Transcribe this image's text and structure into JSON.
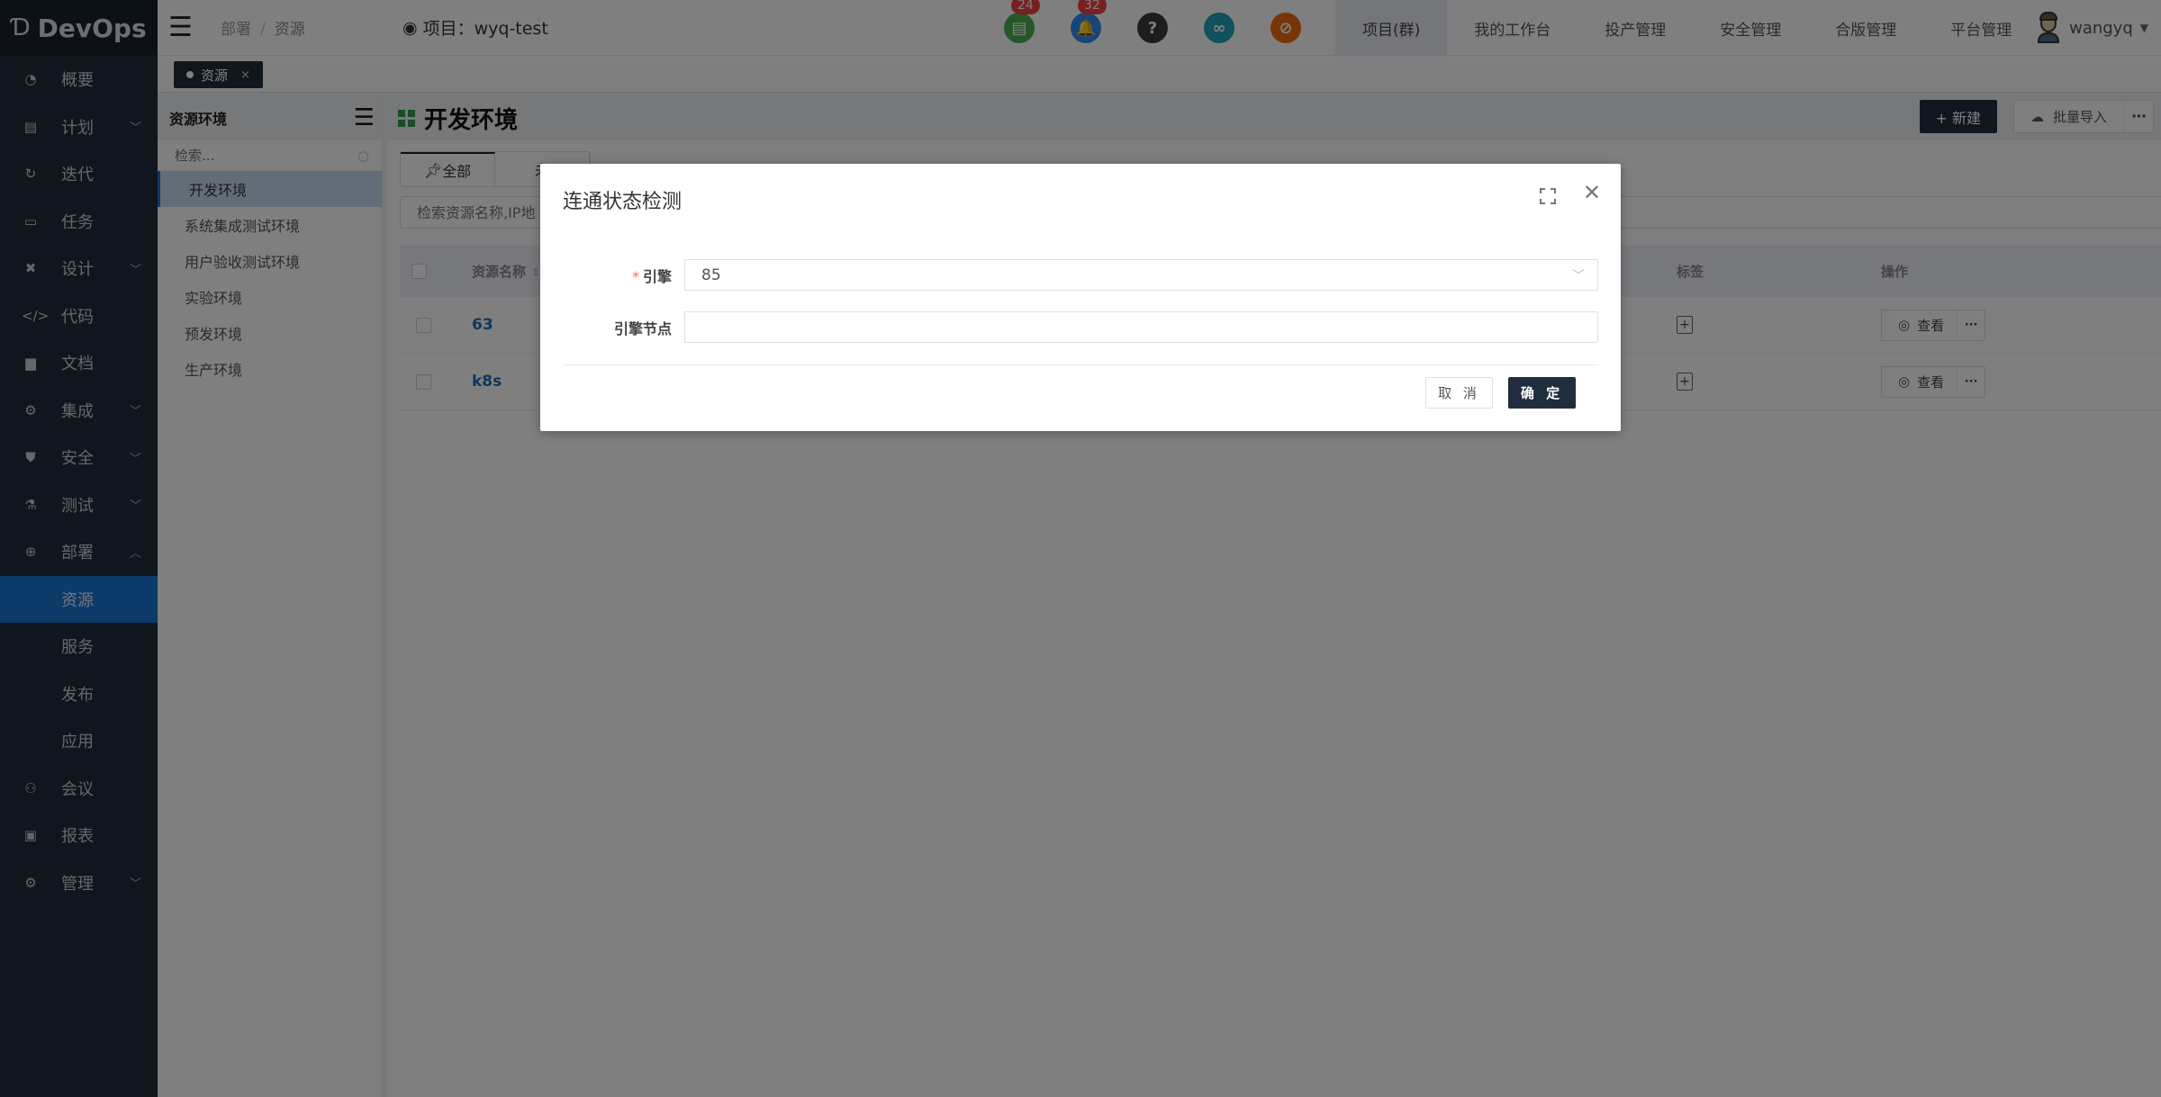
{
  "app": {
    "name": "DevOps"
  },
  "sidebar": {
    "items": [
      {
        "label": "概要",
        "icon": "dashboard-icon",
        "glyph": "◔",
        "expandable": false
      },
      {
        "label": "计划",
        "icon": "plan-icon",
        "glyph": "▤",
        "expandable": true
      },
      {
        "label": "迭代",
        "icon": "iteration-icon",
        "glyph": "↻",
        "expandable": false
      },
      {
        "label": "任务",
        "icon": "task-folder-icon",
        "glyph": "▭",
        "expandable": false
      },
      {
        "label": "设计",
        "icon": "design-tools-icon",
        "glyph": "✖",
        "expandable": true
      },
      {
        "label": "代码",
        "icon": "code-icon",
        "glyph": "</>",
        "expandable": false
      },
      {
        "label": "文档",
        "icon": "document-icon",
        "glyph": "▆",
        "expandable": false
      },
      {
        "label": "集成",
        "icon": "integration-icon",
        "glyph": "⚙",
        "expandable": true
      },
      {
        "label": "安全",
        "icon": "shield-icon",
        "glyph": "⛊",
        "expandable": true
      },
      {
        "label": "测试",
        "icon": "flask-icon",
        "glyph": "⚗",
        "expandable": true
      },
      {
        "label": "部署",
        "icon": "deploy-icon",
        "glyph": "⊕",
        "expandable": true,
        "expanded": true
      }
    ],
    "deploy_children": [
      {
        "label": "资源",
        "active": true
      },
      {
        "label": "服务"
      },
      {
        "label": "发布"
      },
      {
        "label": "应用"
      }
    ],
    "items_after": [
      {
        "label": "会议",
        "icon": "meeting-icon",
        "glyph": "⚇",
        "expandable": false
      },
      {
        "label": "报表",
        "icon": "report-monitor-icon",
        "glyph": "▣",
        "expandable": false
      },
      {
        "label": "管理",
        "icon": "gear-icon",
        "glyph": "⚙",
        "expandable": true
      }
    ]
  },
  "header": {
    "breadcrumb": [
      "部署",
      "资源"
    ],
    "project_label": "项目：wyq-test",
    "icons": [
      {
        "name": "document-notice-icon",
        "glyph": "▤",
        "color": "#4caf50",
        "badge": "24"
      },
      {
        "name": "bell-icon",
        "glyph": "🔔",
        "color": "#2d8cf0",
        "badge": "32"
      },
      {
        "name": "help-icon",
        "glyph": "?",
        "color": "#3a3a3a",
        "badge": null
      },
      {
        "name": "link-icon",
        "glyph": "∞",
        "color": "#1fa2b8",
        "badge": null
      },
      {
        "name": "no-entry-icon",
        "glyph": "⊘",
        "color": "#f06a0f",
        "badge": null
      }
    ],
    "menu": [
      {
        "label": "项目(群)",
        "active": true
      },
      {
        "label": "我的工作台"
      },
      {
        "label": "投产管理"
      },
      {
        "label": "安全管理"
      },
      {
        "label": "合版管理"
      },
      {
        "label": "平台管理"
      }
    ],
    "user": "wangyq"
  },
  "page_tabs": [
    {
      "label": "资源",
      "close": "×"
    }
  ],
  "env_panel": {
    "title": "资源环境",
    "search_placeholder": "检索...",
    "items": [
      {
        "label": "开发环境",
        "active": true
      },
      {
        "label": "系统集成测试环境"
      },
      {
        "label": "用户验收测试环境"
      },
      {
        "label": "实验环境"
      },
      {
        "label": "预发环境"
      },
      {
        "label": "生产环境"
      }
    ]
  },
  "main": {
    "title": "开发环境",
    "new_button": "+ 新建",
    "import_button": "批量导入",
    "more": "···",
    "tabs": [
      {
        "label": "全部",
        "active": true
      },
      {
        "label": "未"
      }
    ],
    "filter_placeholder": "检索资源名称,IP地",
    "table": {
      "columns": {
        "name": "资源名称",
        "tag": "标签",
        "op": "操作"
      },
      "rows": [
        {
          "name": "63",
          "view": "查看"
        },
        {
          "name": "k8s",
          "view": "查看"
        }
      ]
    }
  },
  "modal": {
    "title": "连通状态检测",
    "fields": [
      {
        "label": "引擎",
        "required": true,
        "type": "select",
        "value": "85"
      },
      {
        "label": "引擎节点",
        "required": false,
        "type": "input",
        "value": "",
        "placeholder": ""
      }
    ],
    "cancel": "取 消",
    "ok": "确 定"
  }
}
